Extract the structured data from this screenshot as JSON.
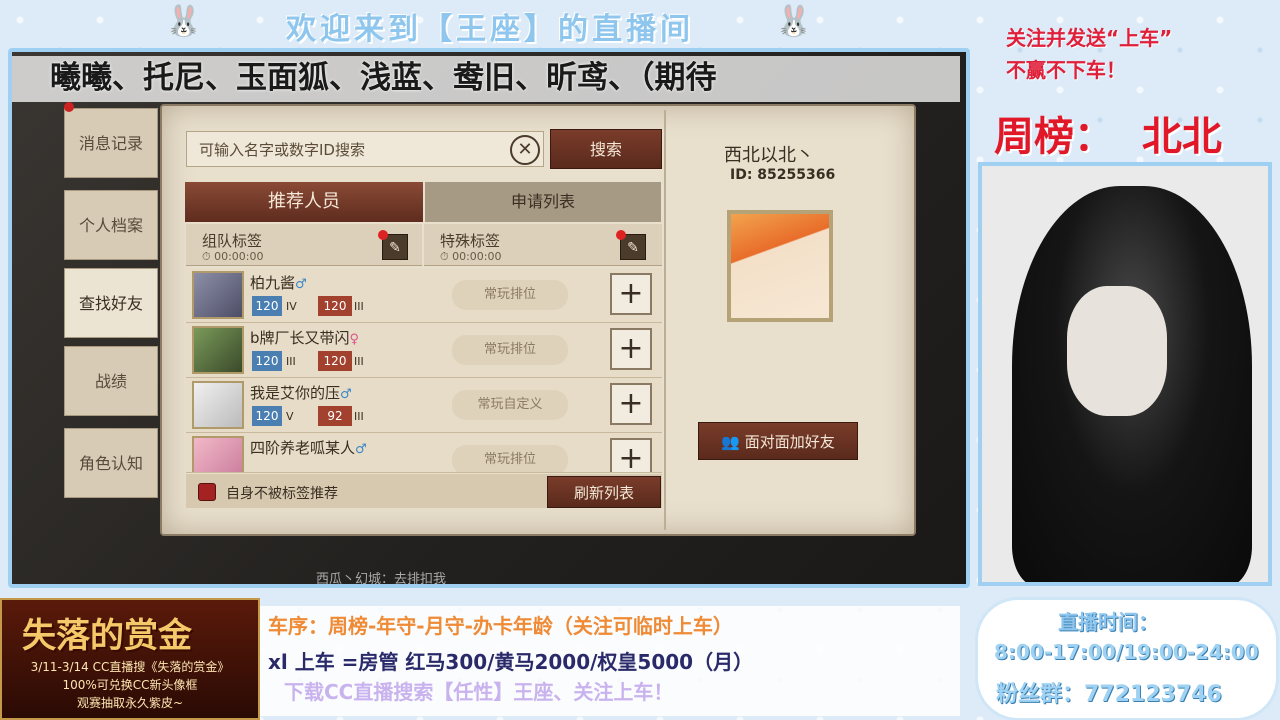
{
  "banner": {
    "title": "欢迎来到【王座】的直播间",
    "marquee": "曦曦、托尼、玉面狐、浅蓝、鸯旧、昕鸢、（期待"
  },
  "game": {
    "left_tabs": [
      "消息记录",
      "个人档案",
      "查找好友",
      "战绩",
      "角色认知"
    ],
    "active_tab": "查找好友",
    "search": {
      "placeholder": "可输入名字或数字ID搜索",
      "clear_icon": "✕",
      "search_button": "搜索"
    },
    "tabs": {
      "recommended": "推荐人员",
      "requests": "申请列表"
    },
    "tag_headers": [
      {
        "title": "组队标签",
        "time": "00:00:00"
      },
      {
        "title": "特殊标签",
        "time": "00:00:00"
      }
    ],
    "players": [
      {
        "name": "柏九酱",
        "gender": "♂",
        "level1": "120",
        "tier1": "IV",
        "level2": "120",
        "tier2": "III",
        "tag": "常玩排位"
      },
      {
        "name": "b牌厂长又带闪",
        "gender": "♀",
        "level1": "120",
        "tier1": "III",
        "level2": "120",
        "tier2": "III",
        "tag": "常玩排位"
      },
      {
        "name": "我是艾你的压",
        "gender": "♂",
        "level1": "120",
        "tier1": "V",
        "level2": "92",
        "tier2": "III",
        "tag": "常玩自定义"
      },
      {
        "name": "四阶养老呱某人",
        "gender": "♂",
        "level1": "",
        "tier1": "",
        "level2": "",
        "tier2": "",
        "tag": "常玩排位"
      }
    ],
    "self_not_recommended": "自身不被标签推荐",
    "refresh_button": "刷新列表",
    "user": {
      "name": "西北以北丶",
      "id": "ID: 85255366",
      "face_to_face_button": "面对面加好友"
    },
    "bottom_text": "西瓜丶幻城：去排扣我"
  },
  "overlay": {
    "follow_line1": "关注并发送“上车”",
    "follow_line2": "不赢不下车！",
    "week_rank": "周榜：  北北"
  },
  "bottom": {
    "line1": "车序：周榜-年守-月守-办卡年龄（关注可临时上车）",
    "line2": "xl 上车  =房管  红马300/黄马2000/权皇5000（月）",
    "line3": "下载CC直播搜索【任性】王座、关注上车！"
  },
  "promo": {
    "title": "失落的赏金",
    "line1": "3/11-3/14 CC直播搜《失落的赏金》",
    "line2": "100%可兑换CC新头像框",
    "line3": "观赛抽取永久紫皮~"
  },
  "schedule": {
    "title": "直播时间：",
    "time": "8:00-17:00/19:00-24:00",
    "fans": "粉丝群：772123746"
  }
}
